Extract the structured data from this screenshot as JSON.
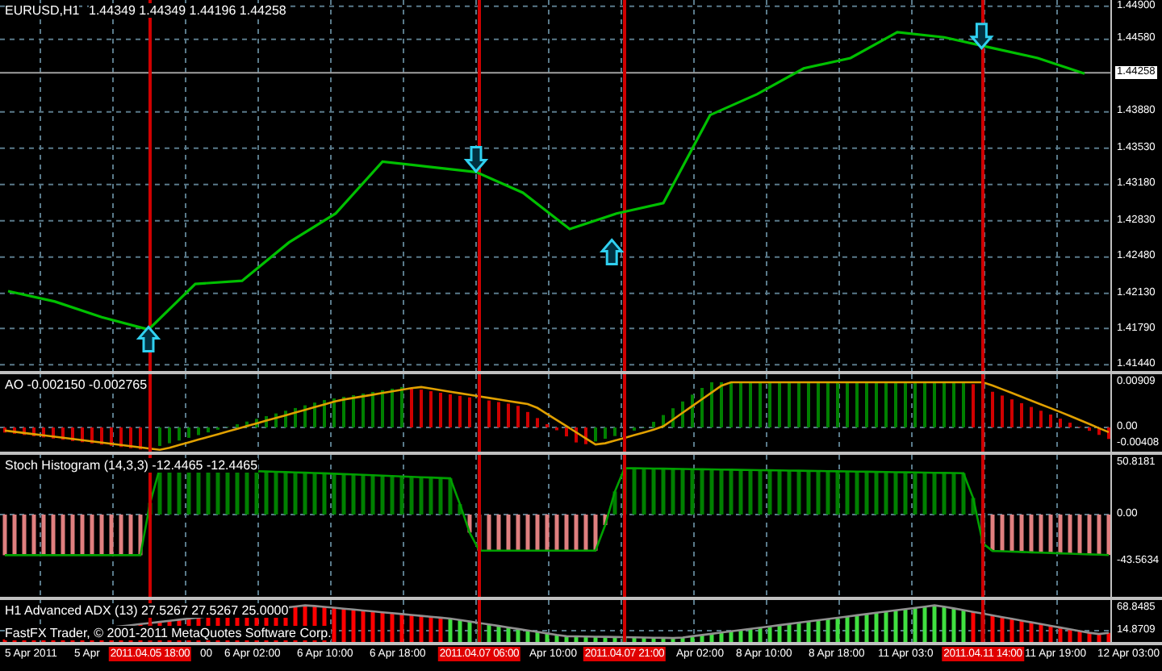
{
  "chart": {
    "symbol": "EURUSD,H1",
    "readings": "1.44349 1.44349 1.44196 1.44258",
    "current_price": "1.44258",
    "price_scale": [
      "1.44900",
      "1.44580",
      "1.43880",
      "1.43530",
      "1.43180",
      "1.42830",
      "1.42480",
      "1.42130",
      "1.41790",
      "1.41440"
    ],
    "signals": [
      {
        "kind": "up"
      },
      {
        "kind": "down"
      },
      {
        "kind": "up"
      },
      {
        "kind": "down"
      }
    ]
  },
  "indicators": [
    {
      "kind": "ao",
      "header": "AO -0.002150 -0.002765",
      "scale": [
        "0.00909",
        "0.00",
        "-0.00408"
      ]
    },
    {
      "kind": "stoch",
      "header": "Stoch Histogram (14,3,3) -12.4465 -12.4465",
      "scale": [
        "50.8181",
        "0.00",
        "-43.5634"
      ]
    },
    {
      "kind": "adx",
      "header": "H1 Advanced ADX (13) 27.5267 27.5267 25.0000",
      "scale": [
        "68.8485",
        "14.8709"
      ],
      "footer": "FastFX Trader, © 2001-2011 MetaQuotes Software Corp."
    }
  ],
  "time_axis": [
    {
      "label": "5 Apr 2011",
      "highlighted": false
    },
    {
      "label": "5 Apr",
      "highlighted": false
    },
    {
      "label": "2011.04.05 18:00",
      "highlighted": true
    },
    {
      "label": "00",
      "highlighted": false
    },
    {
      "label": "6 Apr 02:00",
      "highlighted": false
    },
    {
      "label": "6 Apr 10:00",
      "highlighted": false
    },
    {
      "label": "6 Apr 18:00",
      "highlighted": false
    },
    {
      "label": "2011.04.07 06:00",
      "highlighted": true
    },
    {
      "label": "Apr 10:00",
      "highlighted": false
    },
    {
      "label": "2011.04.07 21:00",
      "highlighted": true
    },
    {
      "label": "Apr 02:00",
      "highlighted": false
    },
    {
      "label": "8 Apr 10:00",
      "highlighted": false
    },
    {
      "label": "8 Apr 18:00",
      "highlighted": false
    },
    {
      "label": "11 Apr 03:0",
      "highlighted": false
    },
    {
      "label": "2011.04.11 14:00",
      "highlighted": true
    },
    {
      "label": "11 Apr 19:00",
      "highlighted": false
    },
    {
      "label": "12 Apr 03:00",
      "highlighted": false
    }
  ]
}
